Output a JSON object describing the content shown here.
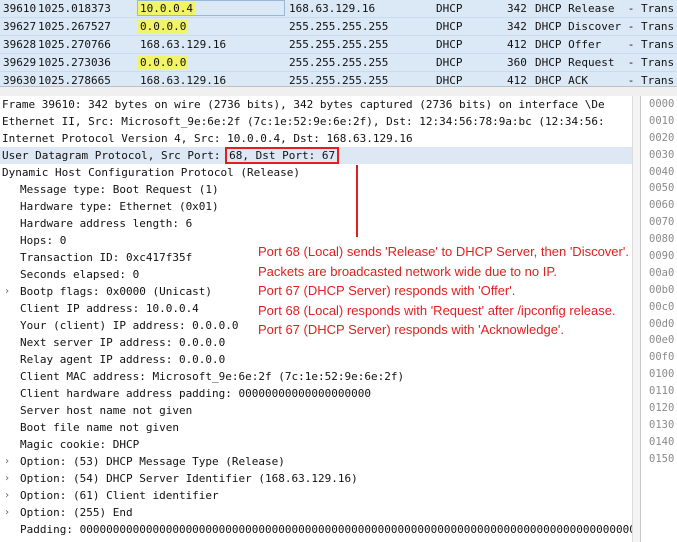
{
  "packets": [
    {
      "no": "39610",
      "time": "1025.018373",
      "src": "10.0.0.4",
      "src_hl": true,
      "dst": "168.63.129.16",
      "proto": "DHCP",
      "len": "342",
      "info": "DHCP Release  - Trans"
    },
    {
      "no": "39627",
      "time": "1025.267527",
      "src": "0.0.0.0",
      "src_hl": true,
      "dst": "255.255.255.255",
      "proto": "DHCP",
      "len": "342",
      "info": "DHCP Discover - Trans"
    },
    {
      "no": "39628",
      "time": "1025.270766",
      "src": "168.63.129.16",
      "src_hl": false,
      "dst": "255.255.255.255",
      "proto": "DHCP",
      "len": "412",
      "info": "DHCP Offer    - Trans"
    },
    {
      "no": "39629",
      "time": "1025.273036",
      "src": "0.0.0.0",
      "src_hl": true,
      "dst": "255.255.255.255",
      "proto": "DHCP",
      "len": "360",
      "info": "DHCP Request  - Trans"
    },
    {
      "no": "39630",
      "time": "1025.278665",
      "src": "168.63.129.16",
      "src_hl": false,
      "dst": "255.255.255.255",
      "proto": "DHCP",
      "len": "412",
      "info": "DHCP ACK      - Trans"
    }
  ],
  "details": {
    "frame": "Frame 39610: 342 bytes on wire (2736 bits), 342 bytes captured (2736 bits) on interface \\De",
    "ethernet": "Ethernet II, Src: Microsoft_9e:6e:2f (7c:1e:52:9e:6e:2f), Dst: 12:34:56:78:9a:bc (12:34:56:",
    "ip": "Internet Protocol Version 4, Src: 10.0.0.4, Dst: 168.63.129.16",
    "udp_prefix": "User Datagram Protocol, Src Port: ",
    "udp_ports": "68, Dst Port: 67",
    "dhcp": "Dynamic Host Configuration Protocol (Release)",
    "fields": [
      {
        "text": "Message type: Boot Request (1)",
        "expand": false
      },
      {
        "text": "Hardware type: Ethernet (0x01)",
        "expand": false
      },
      {
        "text": "Hardware address length: 6",
        "expand": false
      },
      {
        "text": "Hops: 0",
        "expand": false
      },
      {
        "text": "Transaction ID: 0xc417f35f",
        "expand": false
      },
      {
        "text": "Seconds elapsed: 0",
        "expand": false
      },
      {
        "text": "Bootp flags: 0x0000 (Unicast)",
        "expand": true
      },
      {
        "text": "Client IP address: 10.0.0.4",
        "expand": false
      },
      {
        "text": "Your (client) IP address: 0.0.0.0",
        "expand": false
      },
      {
        "text": "Next server IP address: 0.0.0.0",
        "expand": false
      },
      {
        "text": "Relay agent IP address: 0.0.0.0",
        "expand": false
      },
      {
        "text": "Client MAC address: Microsoft_9e:6e:2f (7c:1e:52:9e:6e:2f)",
        "expand": false
      },
      {
        "text": "Client hardware address padding: 00000000000000000000",
        "expand": false
      },
      {
        "text": "Server host name not given",
        "expand": false
      },
      {
        "text": "Boot file name not given",
        "expand": false
      },
      {
        "text": "Magic cookie: DHCP",
        "expand": false
      },
      {
        "text": "Option: (53) DHCP Message Type (Release)",
        "expand": true
      },
      {
        "text": "Option: (54) DHCP Server Identifier (168.63.129.16)",
        "expand": true
      },
      {
        "text": "Option: (61) Client identifier",
        "expand": true
      },
      {
        "text": "Option: (255) End",
        "expand": true
      },
      {
        "text": "Padding: 0000000000000000000000000000000000000000000000000000000000000000000000000000000000000",
        "expand": false
      }
    ]
  },
  "hex_offsets": [
    "0000",
    "0010",
    "0020",
    "0030",
    "0040",
    "0050",
    "0060",
    "0070",
    "0080",
    "0090",
    "00a0",
    "00b0",
    "00c0",
    "00d0",
    "00e0",
    "00f0",
    "0100",
    "0110",
    "0120",
    "0130",
    "0140",
    "0150"
  ],
  "annotation": {
    "lines": [
      "Port 68 (Local) sends 'Release' to DHCP Server, then 'Discover'.",
      "Packets are broadcasted network wide due to no IP.",
      "Port 67 (DHCP Server) responds with 'Offer'.",
      "Port 68 (Local) responds with 'Request' after /ipconfig release.",
      "Port 67 (DHCP Server) responds with 'Acknowledge'."
    ],
    "color": "#e02020"
  },
  "colors": {
    "packet_bg": "#dbe9f7",
    "source_highlight": "#f3f36a",
    "selected_row": "#dde8f4"
  }
}
